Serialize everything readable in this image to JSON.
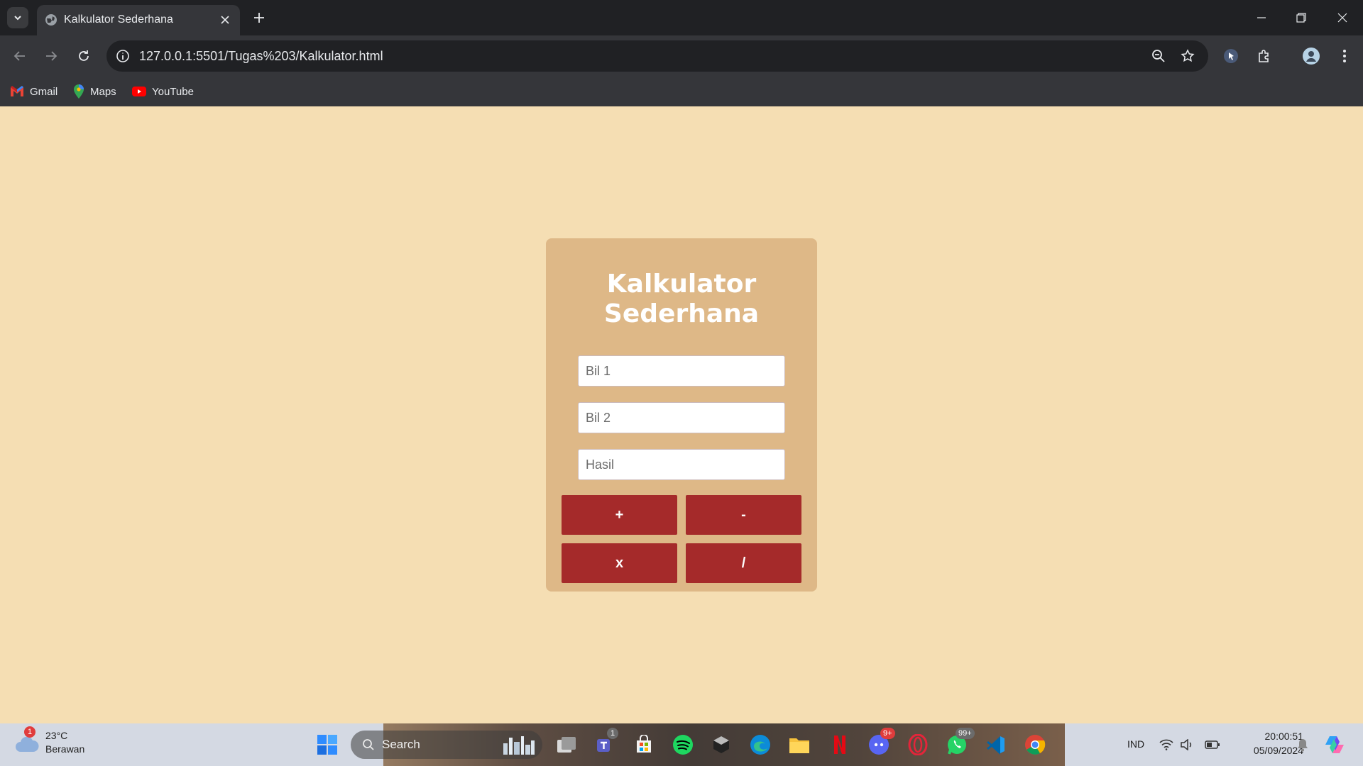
{
  "browser": {
    "tab_title": "Kalkulator Sederhana",
    "url": "127.0.0.1:5501/Tugas%203/Kalkulator.html",
    "bookmarks": [
      {
        "label": "Gmail",
        "icon": "gmail-icon"
      },
      {
        "label": "Maps",
        "icon": "maps-icon"
      },
      {
        "label": "YouTube",
        "icon": "youtube-icon"
      }
    ]
  },
  "calculator": {
    "title": "Kalkulator Sederhana",
    "input1_placeholder": "Bil 1",
    "input2_placeholder": "Bil 2",
    "result_placeholder": "Hasil",
    "buttons": {
      "add": "+",
      "subtract": "-",
      "multiply": "x",
      "divide": "/"
    }
  },
  "taskbar": {
    "weather_temp": "23°C",
    "weather_desc": "Berawan",
    "weather_badge": "1",
    "search_label": "Search",
    "teams_badge": "1",
    "discord_badge": "9+",
    "whatsapp_badge": "99+",
    "language": "IND",
    "time": "20:00:51",
    "date": "05/09/2024"
  },
  "colors": {
    "page_bg": "#f5deb3",
    "card_bg": "#deb887",
    "button_bg": "#a52a2a"
  }
}
